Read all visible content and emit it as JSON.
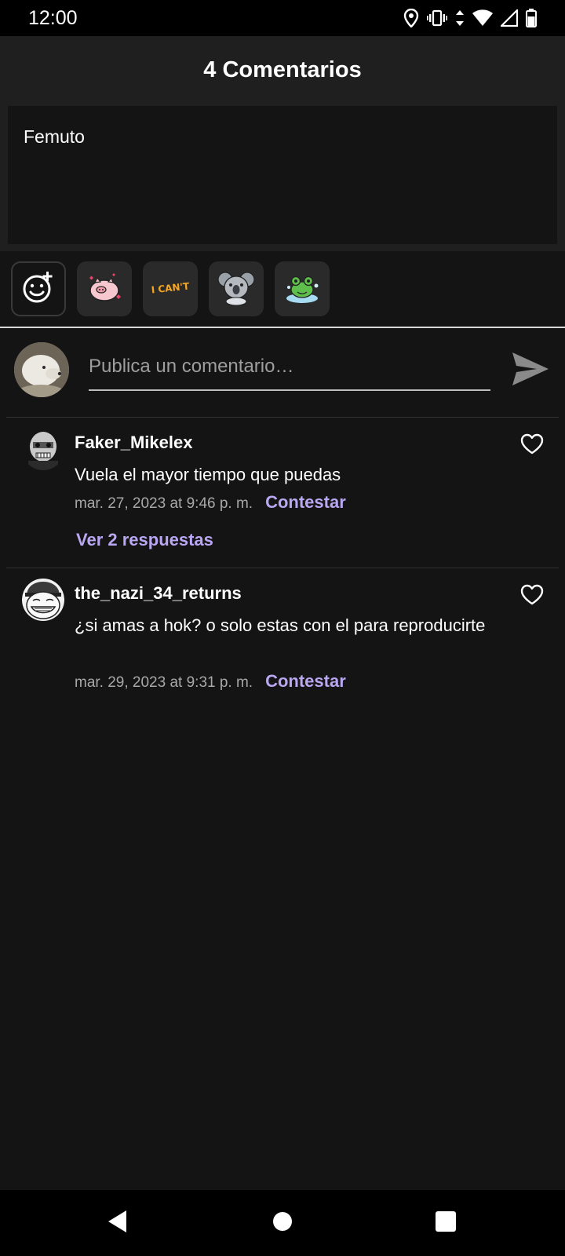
{
  "status_bar": {
    "time": "12:00",
    "icons": [
      "location-icon",
      "vibrate-icon",
      "data-arrows-icon",
      "wifi-icon",
      "signal-icon",
      "battery-icon"
    ]
  },
  "header": {
    "title": "4 Comentarios"
  },
  "post": {
    "text": "Femuto"
  },
  "stickers": [
    {
      "name": "emoji-add-icon"
    },
    {
      "name": "pig-sticker"
    },
    {
      "name": "i-cant-sticker",
      "label": "I CAN'T"
    },
    {
      "name": "koala-sticker"
    },
    {
      "name": "frog-sticker"
    }
  ],
  "composer": {
    "placeholder": "Publica un comentario…",
    "value": ""
  },
  "comments": [
    {
      "username": "Faker_Mikelex",
      "text": "Vuela el mayor tiempo que puedas",
      "timestamp": "mar. 27, 2023 at 9:46 p. m.",
      "reply_label": "Contestar",
      "view_replies": "Ver 2 respuestas"
    },
    {
      "username": "the_nazi_34_returns",
      "text": "¿si amas a hok? o solo estas con el para reproducirte",
      "timestamp": "mar. 29, 2023 at 9:31 p. m.",
      "reply_label": "Contestar"
    }
  ],
  "colors": {
    "background": "#141414",
    "header_bg": "#1f1f1f",
    "accent": "#b9a7f2",
    "muted_text": "#a8a8a8"
  }
}
